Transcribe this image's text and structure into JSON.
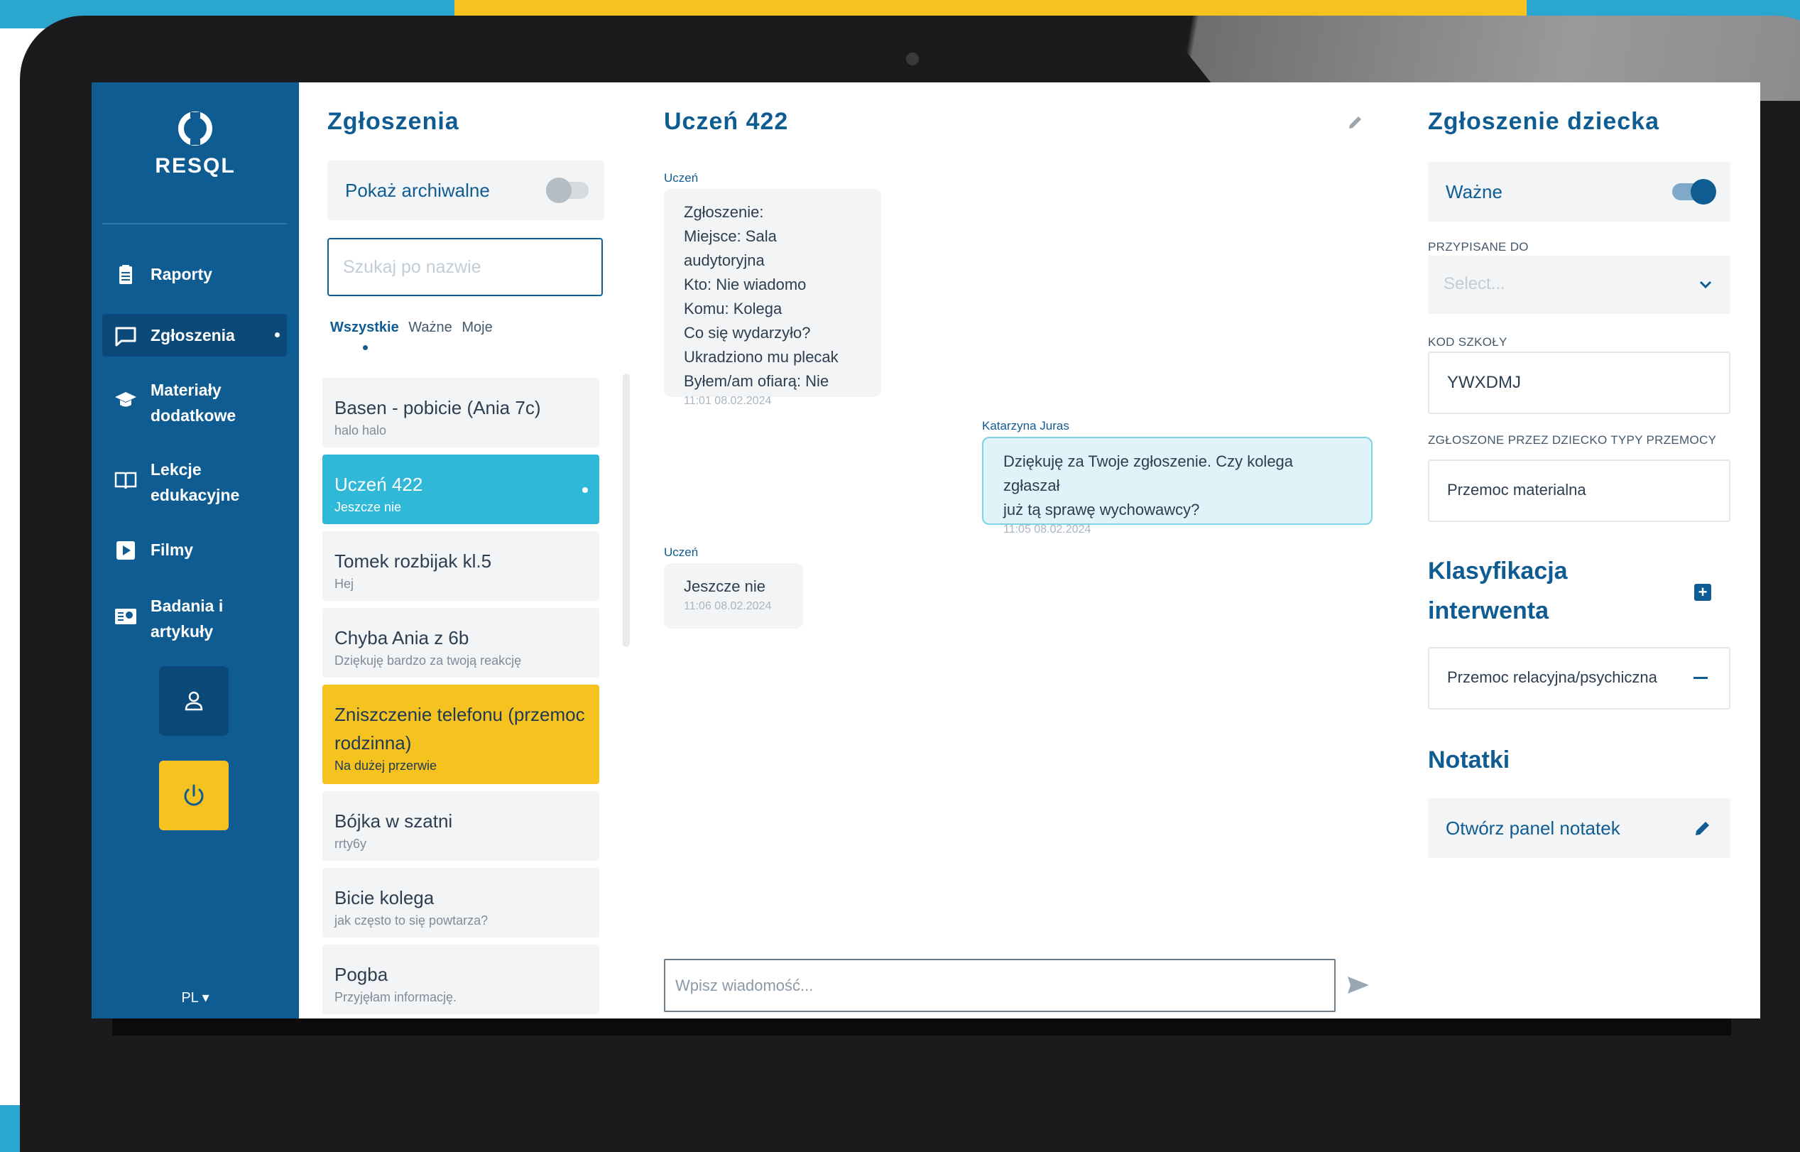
{
  "colors": {
    "brand": "#0f5c93",
    "accent": "#2fb8d8",
    "warning": "#f6c21f",
    "bubble": "#f2f4f6",
    "bubble_me": "#dff3f8"
  },
  "sidebar": {
    "logo_text": "RESQL",
    "items": [
      {
        "label": "Raporty",
        "icon": "clipboard-icon"
      },
      {
        "label": "Zgłoszenia",
        "icon": "chat-icon"
      },
      {
        "label": "Materiały dodatkowe",
        "icon": "graduation-cap-icon"
      },
      {
        "label": "Lekcje edukacyjne",
        "icon": "book-icon"
      },
      {
        "label": "Filmy",
        "icon": "video-icon"
      },
      {
        "label": "Badania i artykuły",
        "icon": "research-icon"
      }
    ],
    "language": "PL ▾"
  },
  "reports": {
    "title": "Zgłoszenia",
    "archive_toggle_label": "Pokaż archiwalne",
    "search_placeholder": "Szukaj po nazwie",
    "filters": [
      "Wszystkie",
      "Ważne",
      "Moje"
    ],
    "items": [
      {
        "title": "Basen - pobicie (Ania 7c)",
        "subtitle": "halo halo"
      },
      {
        "title": "Uczeń 422",
        "subtitle": "Jeszcze nie"
      },
      {
        "title": "Tomek rozbijak kl.5",
        "subtitle": "Hej"
      },
      {
        "title": "Chyba Ania z 6b",
        "subtitle": "Dziękuję bardzo za twoją reakcję"
      },
      {
        "title": "Zniszczenie telefonu (przemoc rodzinna)",
        "subtitle": "Na dużej przerwie"
      },
      {
        "title": "Bójka w szatni",
        "subtitle": "rrty6y"
      },
      {
        "title": "Bicie kolega",
        "subtitle": "jak często to się powtarza?"
      },
      {
        "title": "Pogba",
        "subtitle": "Przyjęłam informację."
      }
    ]
  },
  "chat": {
    "title": "Uczeń 422",
    "messages": [
      {
        "author": "Uczeń",
        "lines": [
          "Zgłoszenie:",
          "Miejsce: Sala audytoryjna",
          "Kto: Nie wiadomo",
          "Komu: Kolega",
          "Co się wydarzyło?",
          "Ukradziono mu plecak",
          "Byłem/am ofiarą: Nie"
        ],
        "time": "11:01 08.02.2024"
      },
      {
        "author": "Katarzyna Juras",
        "lines": [
          "Dziękuję za Twoje zgłoszenie. Czy kolega zgłaszał",
          "już tą sprawę wychowawcy?"
        ],
        "time": "11:05 08.02.2024"
      },
      {
        "author": "Uczeń",
        "lines": [
          "Jeszcze nie"
        ],
        "time": "11:06 08.02.2024"
      }
    ],
    "input_placeholder": "Wpisz wiadomość..."
  },
  "details": {
    "title": "Zgłoszenie dziecka",
    "important_label": "Ważne",
    "assigned_caption": "PRZYPISANE DO",
    "assigned_placeholder": "Select...",
    "school_code_caption": "KOD SZKOŁY",
    "school_code": "YWXDMJ",
    "violence_types_caption": "ZGŁOSZONE PRZEZ DZIECKO TYPY PRZEMOCY",
    "violence_type": "Przemoc materialna",
    "classification_title_line1": "Klasyfikacja",
    "classification_title_line2": "interwenta",
    "classification_item": "Przemoc relacyjna/psychiczna",
    "notes_title": "Notatki",
    "notes_button": "Otwórz panel notatek"
  }
}
